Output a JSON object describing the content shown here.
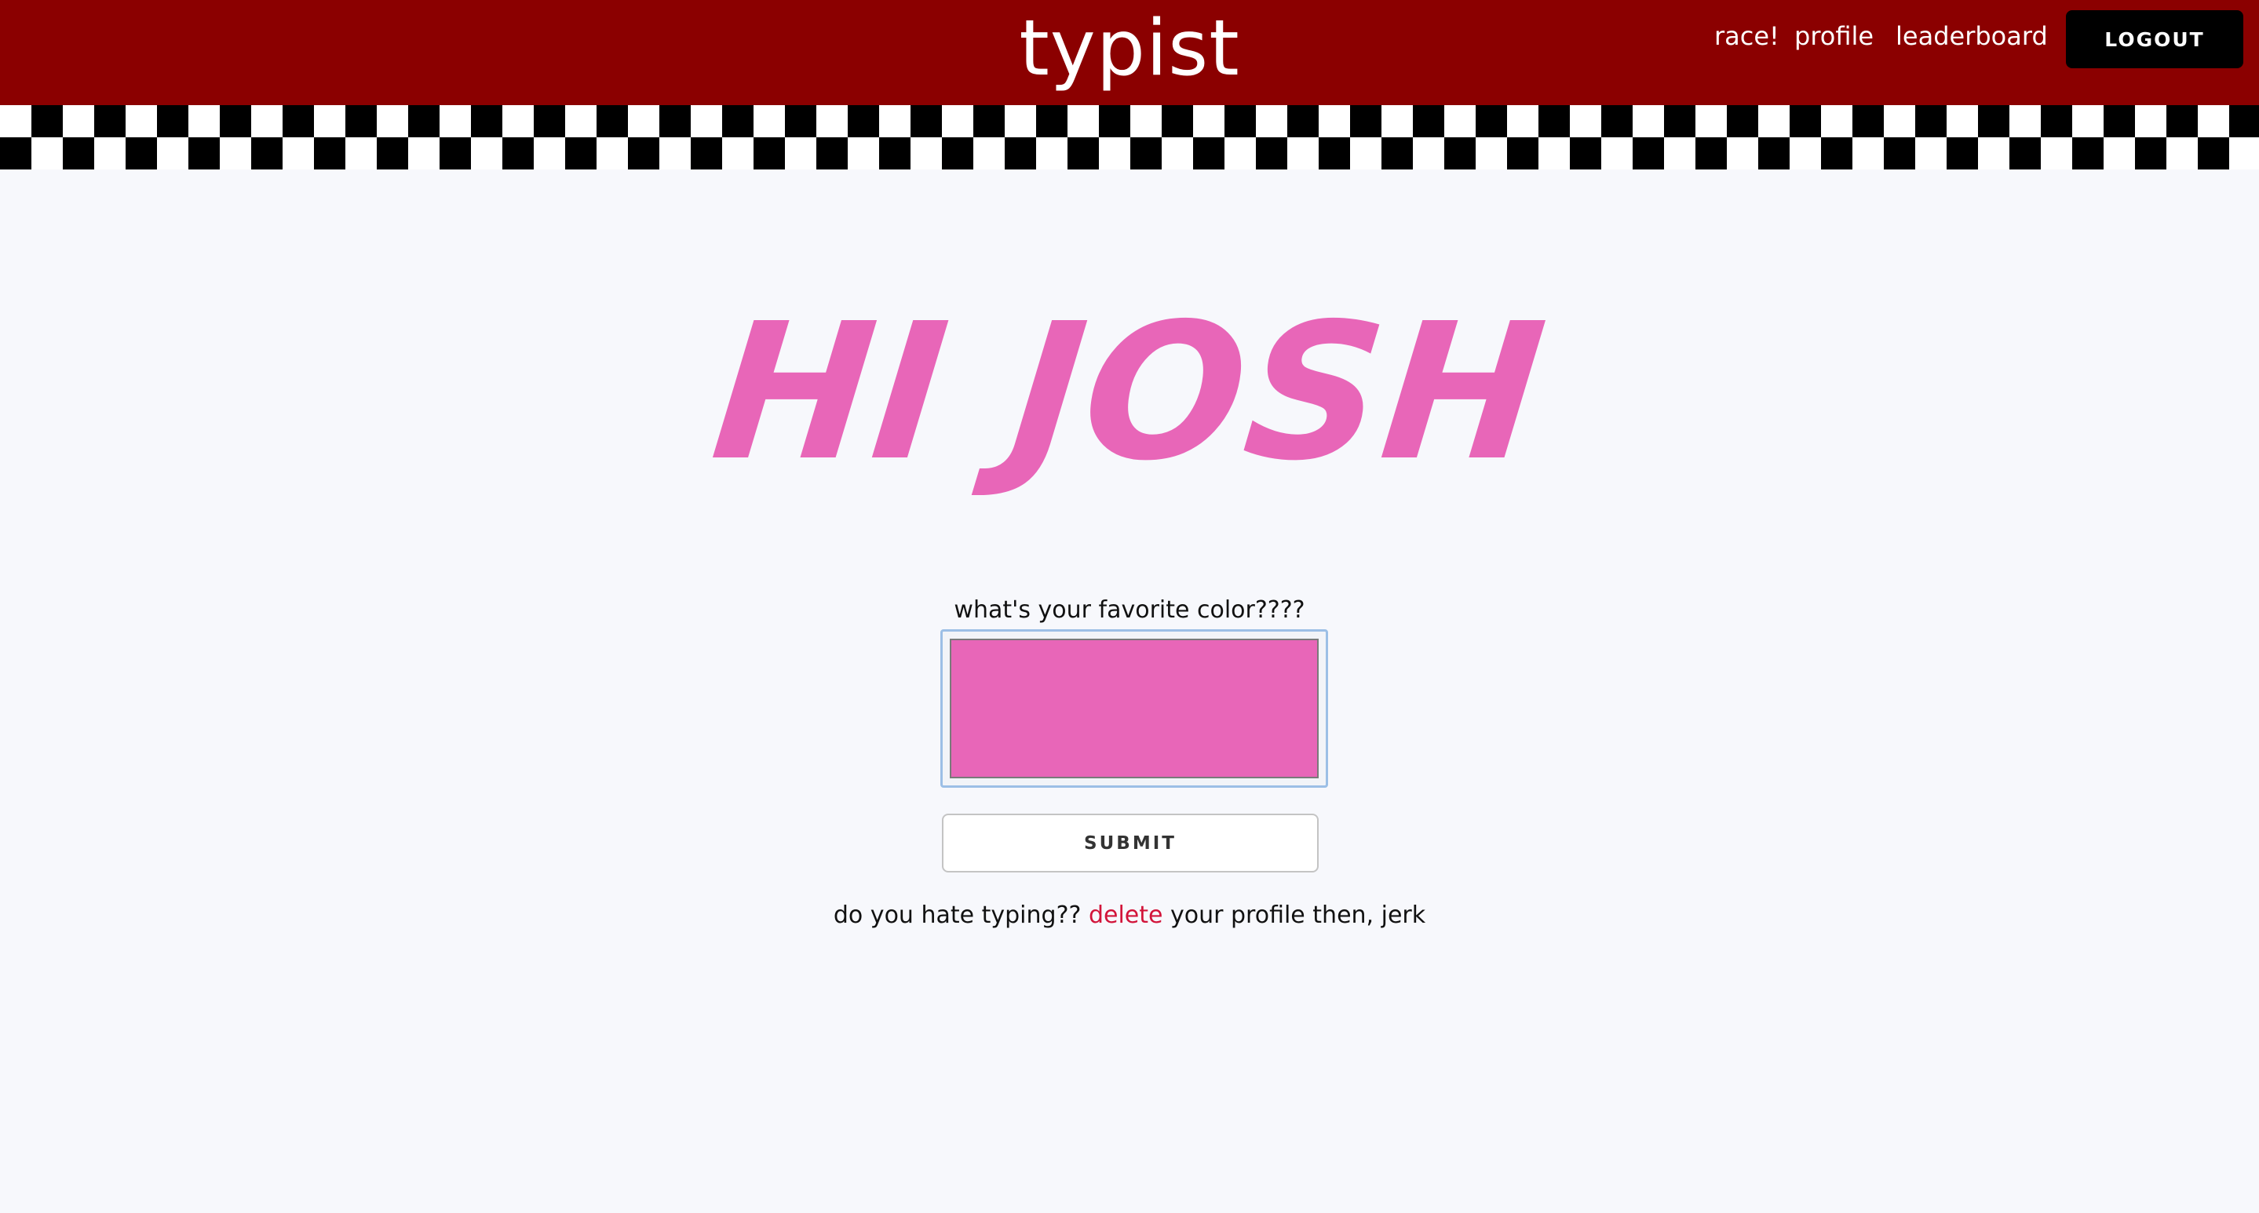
{
  "navbar": {
    "brand": "typist",
    "links": [
      "race!",
      "profile",
      "leaderboard"
    ],
    "logout_label": "LOGOUT",
    "background_color": "#8b0000"
  },
  "main": {
    "greeting": "HI JOSH",
    "greeting_color": "#e866b8",
    "color_prompt": "what's your favorite color????",
    "color_value": "#e866b8",
    "submit_label": "SUBMIT",
    "delete_prefix": "do you hate typing?? ",
    "delete_link": "delete",
    "delete_suffix": " your profile then, jerk"
  }
}
